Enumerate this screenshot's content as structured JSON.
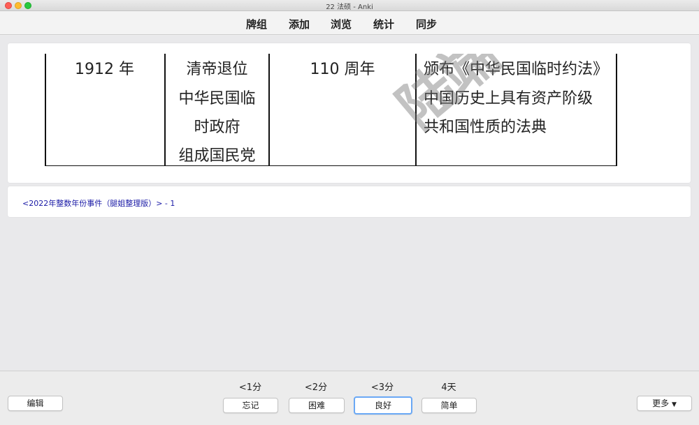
{
  "window": {
    "title": "22 法硕 - Anki"
  },
  "nav": {
    "items": [
      "牌组",
      "添加",
      "浏览",
      "统计",
      "同步"
    ]
  },
  "card": {
    "year": "1912 年",
    "event_lines": [
      "清帝退位",
      "中华民国临",
      "时政府",
      "组成国民党"
    ],
    "anniversary": "110 周年",
    "significance_lines": [
      "颁布《中华民国临时约法》",
      "中国历史上具有资产阶级",
      "共和国性质的法典"
    ],
    "watermark": "陆端"
  },
  "source": {
    "text": "<2022年整数年份事件（腿姐整理版）> - 1"
  },
  "answer": {
    "edit_label": "编辑",
    "more_label": "更多",
    "buttons": [
      {
        "interval": "<1分",
        "label": "忘记"
      },
      {
        "interval": "<2分",
        "label": "困难"
      },
      {
        "interval": "<3分",
        "label": "良好"
      },
      {
        "interval": "4天",
        "label": "简单"
      }
    ]
  }
}
